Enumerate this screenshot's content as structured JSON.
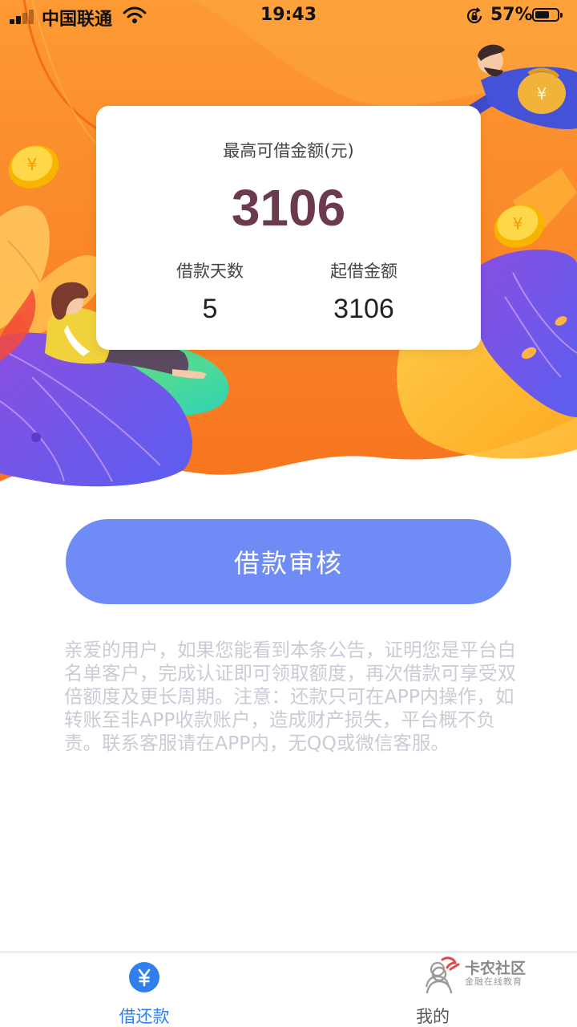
{
  "status_bar": {
    "carrier": "中国联通",
    "time": "19:43",
    "battery_percent": "57%",
    "battery_level": 0.57,
    "icons": [
      "signal-icon",
      "wifi-icon",
      "orientation-lock-icon",
      "battery-icon"
    ]
  },
  "colors": {
    "hero_orange": "#fb8a2b",
    "hero_orange_dark": "#f56b1d",
    "amount_color": "#6b3a4f",
    "button_blue": "#6f8cf6",
    "tab_active": "#2f80ed",
    "notice_text": "#c9ccd6"
  },
  "card": {
    "title": "最高可借金额(元)",
    "amount": "3106",
    "stats": [
      {
        "label": "借款天数",
        "value": "5"
      },
      {
        "label": "起借金额",
        "value": "3106"
      }
    ]
  },
  "primary_button": {
    "label": "借款审核"
  },
  "notice": {
    "text": "亲爱的用户，如果您能看到本条公告，证明您是平台白名单客户，完成认证即可领取额度，再次借款可享受双倍额度及更长周期。注意：还款只可在APP内操作，如转账至非APP收款账户，造成财产损失，平台概不负责。联系客服请在APP内，无QQ或微信客服。"
  },
  "tab_bar": {
    "tabs": [
      {
        "label": "借还款",
        "icon": "yuan-circle-icon",
        "active": true
      },
      {
        "label": "我的",
        "icon": "user-icon",
        "active": false
      }
    ]
  },
  "watermark": {
    "title": "卡农社区",
    "subtitle": "金融在线教育"
  }
}
